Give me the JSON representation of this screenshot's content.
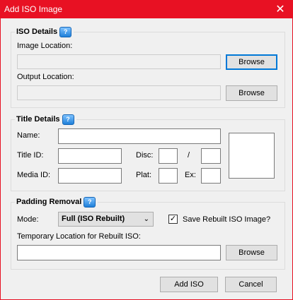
{
  "window": {
    "title": "Add ISO Image",
    "close_glyph": "✕"
  },
  "iso_details": {
    "legend": "ISO Details",
    "help_glyph": "?",
    "image_location_label": "Image Location:",
    "image_location_value": "",
    "image_browse": "Browse",
    "output_location_label": "Output Location:",
    "output_location_value": "",
    "output_browse": "Browse"
  },
  "title_details": {
    "legend": "Title Details",
    "help_glyph": "?",
    "name_label": "Name:",
    "title_id_label": "Title ID:",
    "disc_label": "Disc:",
    "slash": "/",
    "media_id_label": "Media ID:",
    "plat_label": "Plat:",
    "ex_label": "Ex:"
  },
  "padding_removal": {
    "legend": "Padding Removal",
    "help_glyph": "?",
    "mode_label": "Mode:",
    "mode_value": "Full (ISO Rebuilt)",
    "save_rebuilt_label": "Save Rebuilt ISO Image?",
    "save_rebuilt_checked": true,
    "check_glyph": "✓",
    "temp_location_label": "Temporary Location for Rebuilt ISO:",
    "temp_browse": "Browse"
  },
  "footer": {
    "add_iso": "Add ISO",
    "cancel": "Cancel"
  }
}
